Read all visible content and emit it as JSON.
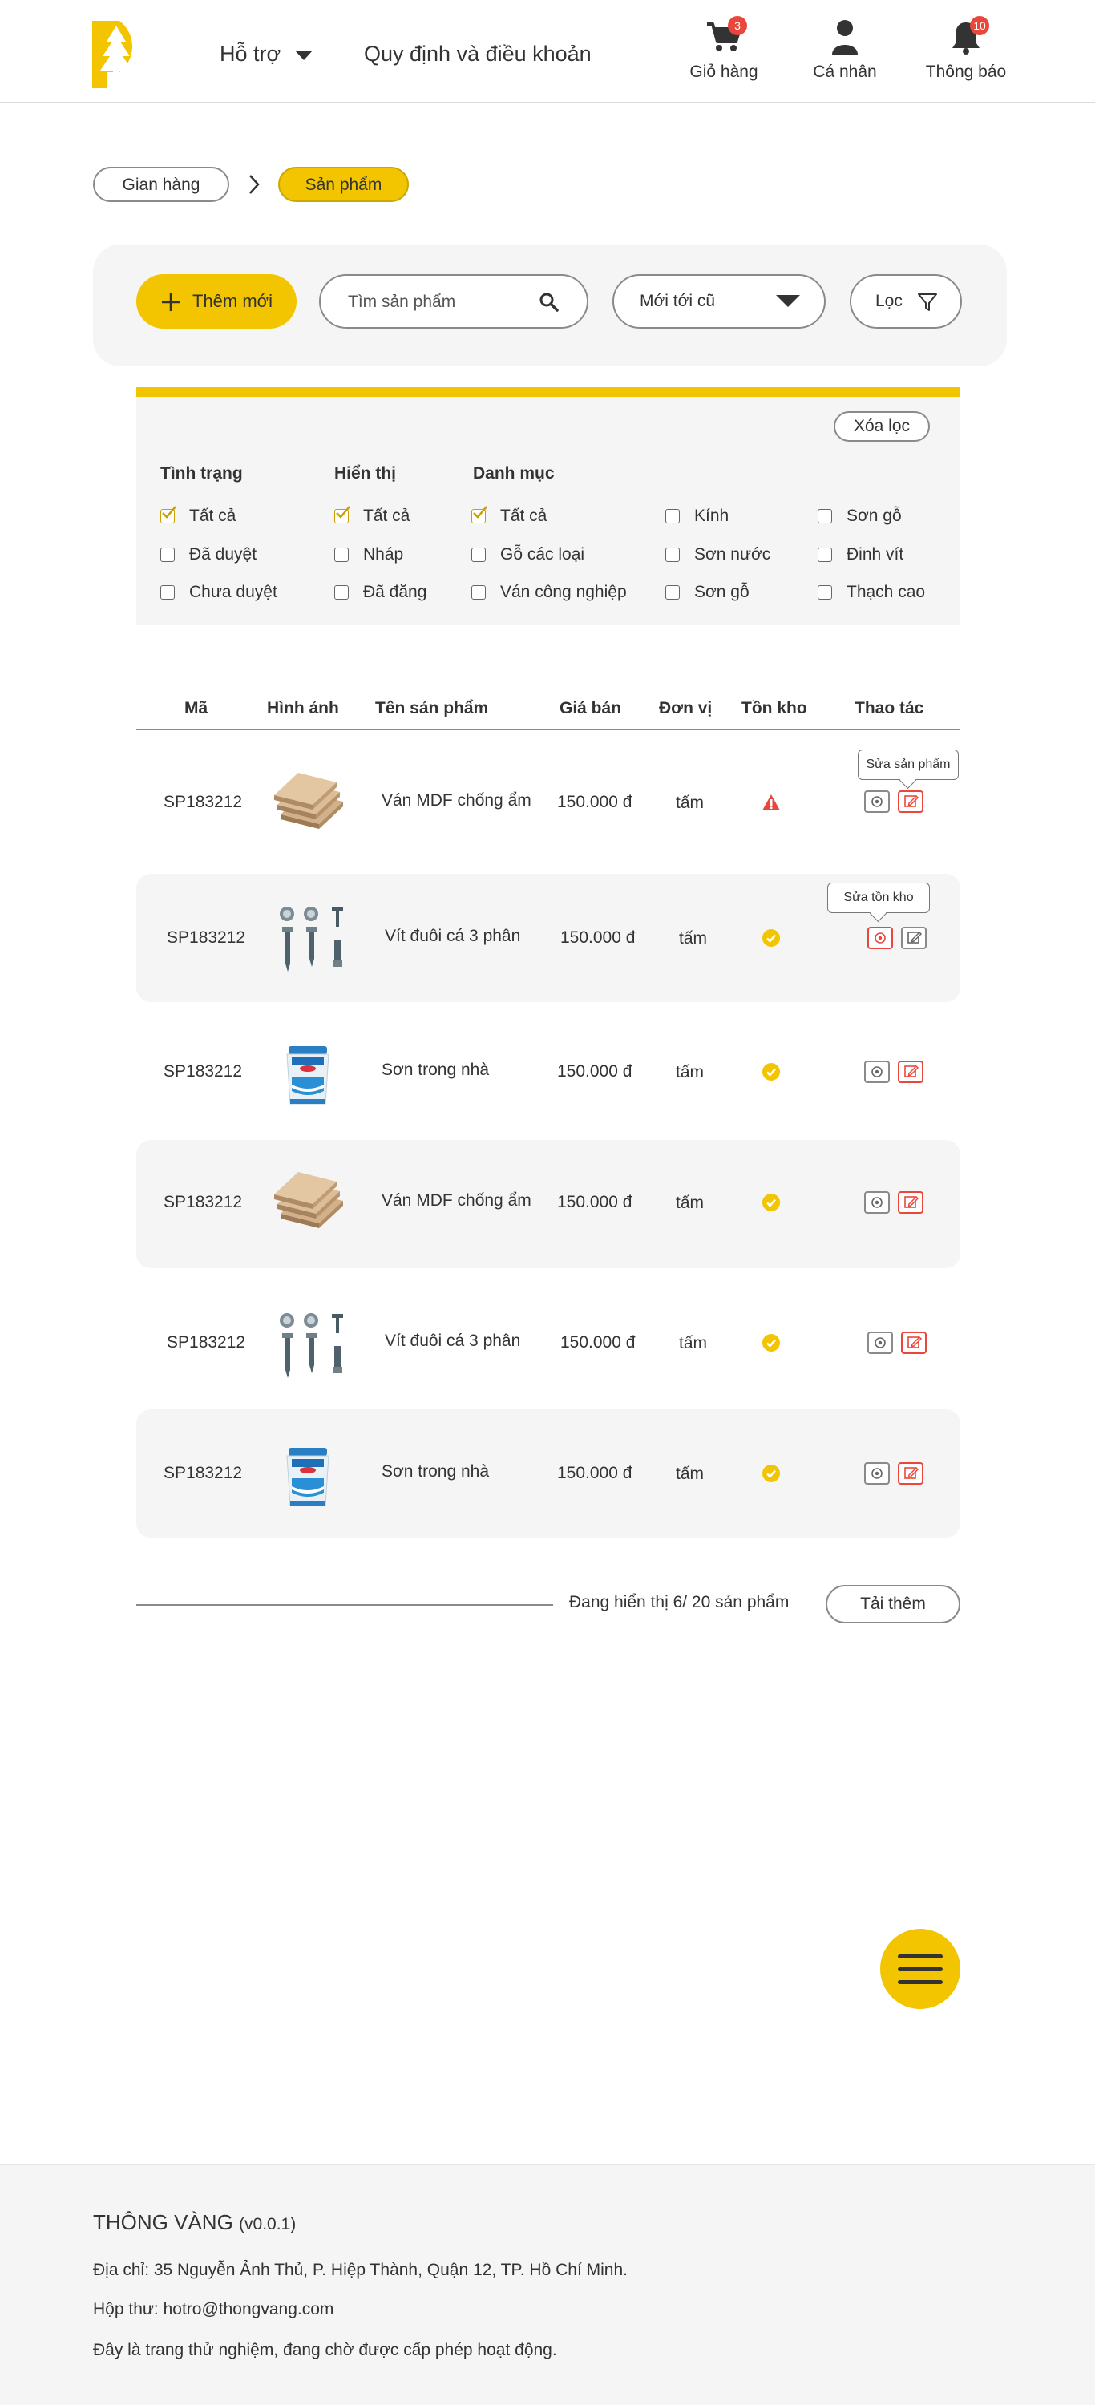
{
  "header": {
    "support_label": "Hỗ trợ",
    "rules_label": "Quy định và điều khoản",
    "cart": {
      "label": "Giỏ hàng",
      "count": "3"
    },
    "profile": {
      "label": "Cá nhân"
    },
    "notifications": {
      "label": "Thông báo",
      "count": "10"
    }
  },
  "breadcrumb": {
    "items": [
      "Gian hàng",
      "Sản phẩm"
    ]
  },
  "toolbar": {
    "add_label": "Thêm mới",
    "search_placeholder": "Tìm sản phẩm",
    "sort_value": "Mới tới cũ",
    "filter_label": "Lọc"
  },
  "filters": {
    "clear_label": "Xóa lọc",
    "status": {
      "title": "Tình trạng",
      "options": [
        "Tất cả",
        "Đã duyệt",
        "Chưa duyệt"
      ]
    },
    "display": {
      "title": "Hiển thị",
      "options": [
        "Tất cả",
        "Nháp",
        "Đã đăng"
      ]
    },
    "category": {
      "title": "Danh mục",
      "col1": [
        "Tất cả",
        "Gỗ các loại",
        "Ván công nghiệp"
      ],
      "col2": [
        "Kính",
        "Sơn nước",
        "Sơn gỗ"
      ],
      "col3": [
        "Sơn gỗ",
        "Đinh vít",
        "Thạch cao"
      ]
    },
    "checked": [
      "Tất cả"
    ]
  },
  "table": {
    "headers": [
      "Mã",
      "Hình ảnh",
      "Tên sản phẩm",
      "Giá bán",
      "Đơn vị",
      "Tồn kho",
      "Thao tác"
    ],
    "rows": [
      {
        "code": "SP183212",
        "image": "mdf-board",
        "name": "Ván MDF chống ẩm",
        "price": "150.000 đ",
        "unit": "tấm",
        "stock": "warning"
      },
      {
        "code": "SP183212",
        "image": "screws",
        "name": "Vít đuôi cá 3 phân",
        "price": "150.000 đ",
        "unit": "tấm",
        "stock": "ok"
      },
      {
        "code": "SP183212",
        "image": "paint-bucket",
        "name": "Sơn trong nhà",
        "price": "150.000 đ",
        "unit": "tấm",
        "stock": "ok"
      },
      {
        "code": "SP183212",
        "image": "mdf-board",
        "name": "Ván MDF chống ẩm",
        "price": "150.000 đ",
        "unit": "tấm",
        "stock": "ok"
      },
      {
        "code": "SP183212",
        "image": "screws",
        "name": "Vít đuôi cá 3 phân",
        "price": "150.000 đ",
        "unit": "tấm",
        "stock": "ok"
      },
      {
        "code": "SP183212",
        "image": "paint-bucket",
        "name": "Sơn trong nhà",
        "price": "150.000 đ",
        "unit": "tấm",
        "stock": "ok"
      }
    ],
    "tooltips": {
      "edit_product": "Sửa sản phẩm",
      "edit_stock": "Sửa tồn kho"
    }
  },
  "pagination": {
    "status": "Đang hiển thị 6/ 20 sản phẩm",
    "load_more": "Tải thêm"
  },
  "footer": {
    "brand": "THÔNG VÀNG",
    "version": "(v0.0.1)",
    "address": "Địa chỉ: 35 Nguyễn Ảnh Thủ, P. Hiệp Thành, Quận 12, TP. Hồ Chí Minh.",
    "email": "Hộp thư: hotro@thongvang.com",
    "notice": "Đây là trang thử nghiệm, đang chờ được cấp phép hoạt động."
  },
  "colors": {
    "accent": "#f2c500",
    "danger": "#e9463c",
    "panel": "#f5f5f5",
    "text": "#333333"
  }
}
